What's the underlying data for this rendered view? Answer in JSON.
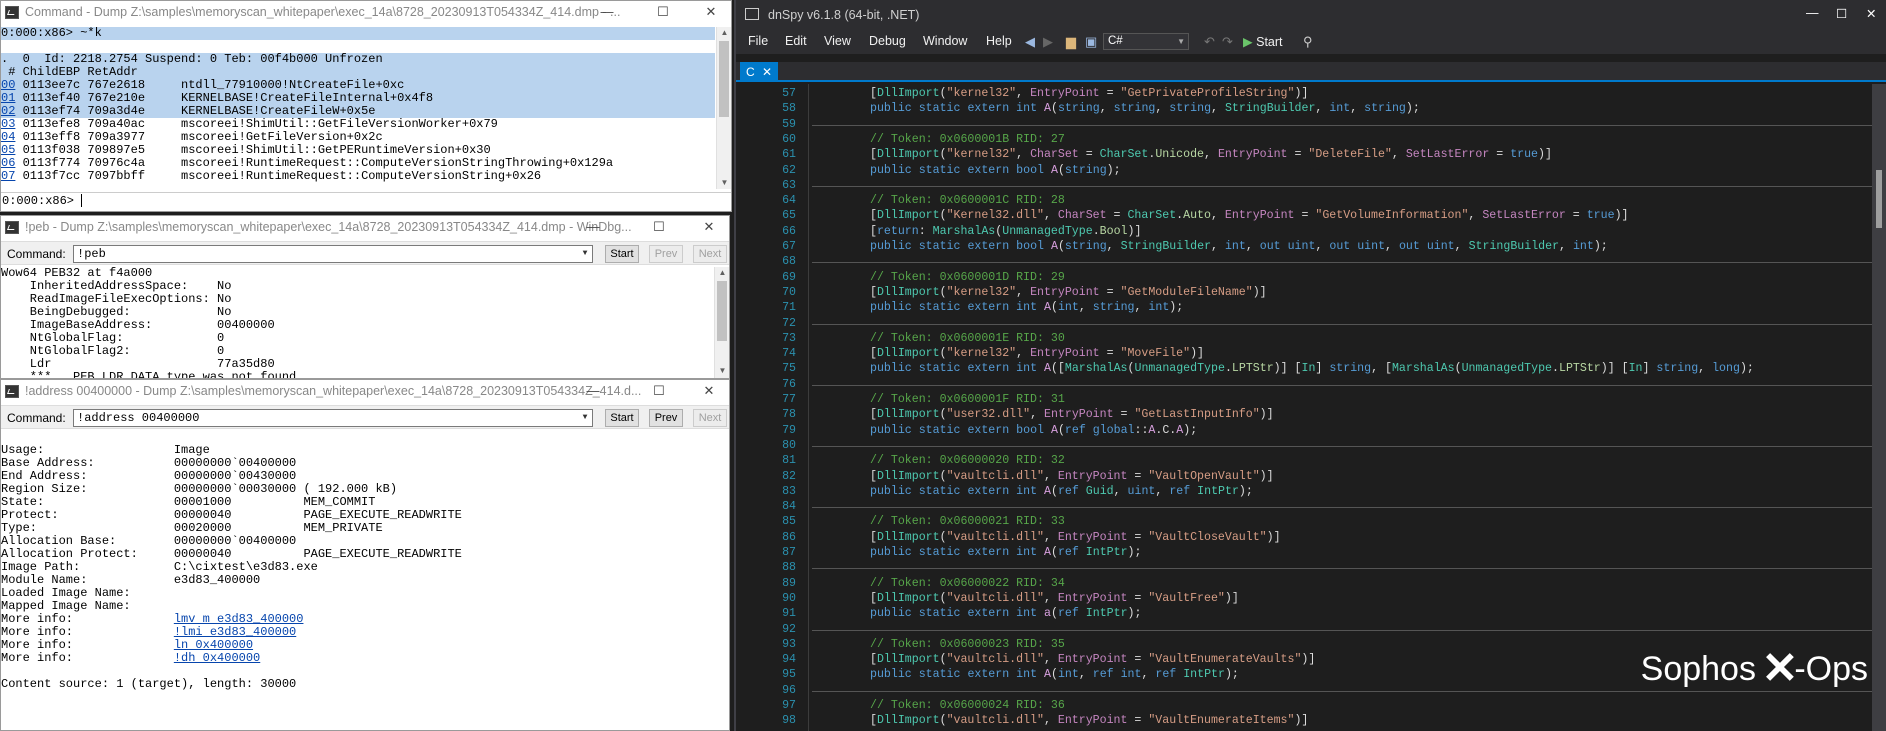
{
  "windbg_cmd": {
    "title": "Command - Dump Z:\\samples\\memoryscan_whitepaper\\exec_14a\\8728_20230913T054334Z_414.dmp - ...",
    "lines": [
      "0:000:x86> ~*k",
      "",
      ".  0  Id: 2218.2754 Suspend: 0 Teb: 00f4b000 Unfrozen",
      " # ChildEBP RetAddr",
      "00 0113ee7c 767e2618     ntdll_77910000!NtCreateFile+0xc",
      "01 0113ef40 767e210e     KERNELBASE!CreateFileInternal+0x4f8",
      "02 0113ef74 709a3d4e     KERNELBASE!CreateFileW+0x5e",
      "03 0113efe8 709a40ac     mscoreei!ShimUtil::GetFileVersionWorker+0x79",
      "04 0113eff8 709a3977     mscoreei!GetFileVersion+0x2c",
      "05 0113f038 709897e5     mscoreei!ShimUtil::GetPERuntimeVersion+0x30",
      "06 0113f774 70976c4a     mscoreei!RuntimeRequest::ComputeVersionStringThrowing+0x129a",
      "07 0113f7cc 7097bbff     mscoreei!RuntimeRequest::ComputeVersionString+0x26"
    ],
    "prompt": "0:000:x86>"
  },
  "windbg_peb": {
    "title": "!peb - Dump Z:\\samples\\memoryscan_whitepaper\\exec_14a\\8728_20230913T054334Z_414.dmp - WinDbg...",
    "command_label": "Command:",
    "command_value": "!peb",
    "start_label": "Start",
    "prev_label": "Prev",
    "next_label": "Next",
    "lines": [
      "Wow64 PEB32 at f4a000",
      "    InheritedAddressSpace:    No",
      "    ReadImageFileExecOptions: No",
      "    BeingDebugged:            No",
      "    ImageBaseAddress:         00400000",
      "    NtGlobalFlag:             0",
      "    NtGlobalFlag2:            0",
      "    Ldr                       77a35d80",
      "    ***  _PEB_LDR_DATA type was not found..."
    ]
  },
  "windbg_addr": {
    "title": "!address 00400000 - Dump Z:\\samples\\memoryscan_whitepaper\\exec_14a\\8728_20230913T054334Z_414.d...",
    "command_label": "Command:",
    "command_value": "!address 00400000",
    "start_label": "Start",
    "prev_label": "Prev",
    "next_label": "Next",
    "lines": [
      "",
      "Usage:                  Image",
      "Base Address:           00000000`00400000",
      "End Address:            00000000`00430000",
      "Region Size:            00000000`00030000 ( 192.000 kB)",
      "State:                  00001000          MEM_COMMIT",
      "Protect:                00000040          PAGE_EXECUTE_READWRITE",
      "Type:                   00020000          MEM_PRIVATE",
      "Allocation Base:        00000000`00400000",
      "Allocation Protect:     00000040          PAGE_EXECUTE_READWRITE",
      "Image Path:             C:\\cixtest\\e3d83.exe",
      "Module Name:            e3d83_400000",
      "Loaded Image Name:",
      "Mapped Image Name:"
    ],
    "more_info_label": "More info:",
    "more_info_links": [
      "lmv m e3d83_400000",
      "!lmi e3d83_400000",
      "ln 0x400000",
      "!dh 0x400000"
    ],
    "content_source": "Content source: 1 (target), length: 30000"
  },
  "dnspy": {
    "title": "dnSpy v6.1.8 (64-bit, .NET)",
    "menu": [
      "File",
      "Edit",
      "View",
      "Debug",
      "Window",
      "Help"
    ],
    "language": "C#",
    "start_label": "Start",
    "tab_label": "C",
    "code": [
      {
        "n": "57",
        "t": "[DllImport(\"kernel32\", EntryPoint = \"GetPrivateProfileString\")]"
      },
      {
        "n": "58",
        "t": "public static extern int A(string, string, string, StringBuilder, int, string);"
      },
      {
        "n": "59",
        "t": ""
      },
      {
        "n": "60",
        "t": "// Token: 0x0600001B RID: 27"
      },
      {
        "n": "61",
        "t": "[DllImport(\"kernel32\", CharSet = CharSet.Unicode, EntryPoint = \"DeleteFile\", SetLastError = true)]"
      },
      {
        "n": "62",
        "t": "public static extern bool A(string);"
      },
      {
        "n": "63",
        "t": ""
      },
      {
        "n": "64",
        "t": "// Token: 0x0600001C RID: 28"
      },
      {
        "n": "65",
        "t": "[DllImport(\"Kernel32.dll\", CharSet = CharSet.Auto, EntryPoint = \"GetVolumeInformation\", SetLastError = true)]"
      },
      {
        "n": "66",
        "t": "[return: MarshalAs(UnmanagedType.Bool)]"
      },
      {
        "n": "67",
        "t": "public static extern bool A(string, StringBuilder, int, out uint, out uint, out uint, StringBuilder, int);"
      },
      {
        "n": "68",
        "t": ""
      },
      {
        "n": "69",
        "t": "// Token: 0x0600001D RID: 29"
      },
      {
        "n": "70",
        "t": "[DllImport(\"kernel32\", EntryPoint = \"GetModuleFileName\")]"
      },
      {
        "n": "71",
        "t": "public static extern int A(int, string, int);"
      },
      {
        "n": "72",
        "t": ""
      },
      {
        "n": "73",
        "t": "// Token: 0x0600001E RID: 30"
      },
      {
        "n": "74",
        "t": "[DllImport(\"kernel32\", EntryPoint = \"MoveFile\")]"
      },
      {
        "n": "75",
        "t": "public static extern int A([MarshalAs(UnmanagedType.LPTStr)] [In] string, [MarshalAs(UnmanagedType.LPTStr)] [In] string, long);"
      },
      {
        "n": "76",
        "t": ""
      },
      {
        "n": "77",
        "t": "// Token: 0x0600001F RID: 31"
      },
      {
        "n": "78",
        "t": "[DllImport(\"user32.dll\", EntryPoint = \"GetLastInputInfo\")]"
      },
      {
        "n": "79",
        "t": "public static extern bool A(ref global::A.C.A);"
      },
      {
        "n": "80",
        "t": ""
      },
      {
        "n": "81",
        "t": "// Token: 0x06000020 RID: 32"
      },
      {
        "n": "82",
        "t": "[DllImport(\"vaultcli.dll\", EntryPoint = \"VaultOpenVault\")]"
      },
      {
        "n": "83",
        "t": "public static extern int A(ref Guid, uint, ref IntPtr);"
      },
      {
        "n": "84",
        "t": ""
      },
      {
        "n": "85",
        "t": "// Token: 0x06000021 RID: 33"
      },
      {
        "n": "86",
        "t": "[DllImport(\"vaultcli.dll\", EntryPoint = \"VaultCloseVault\")]"
      },
      {
        "n": "87",
        "t": "public static extern int A(ref IntPtr);"
      },
      {
        "n": "88",
        "t": ""
      },
      {
        "n": "89",
        "t": "// Token: 0x06000022 RID: 34"
      },
      {
        "n": "90",
        "t": "[DllImport(\"vaultcli.dll\", EntryPoint = \"VaultFree\")]"
      },
      {
        "n": "91",
        "t": "public static extern int a(ref IntPtr);"
      },
      {
        "n": "92",
        "t": ""
      },
      {
        "n": "93",
        "t": "// Token: 0x06000023 RID: 35"
      },
      {
        "n": "94",
        "t": "[DllImport(\"vaultcli.dll\", EntryPoint = \"VaultEnumerateVaults\")]"
      },
      {
        "n": "95",
        "t": "public static extern int A(int, ref int, ref IntPtr);"
      },
      {
        "n": "96",
        "t": ""
      },
      {
        "n": "97",
        "t": "// Token: 0x06000024 RID: 36"
      },
      {
        "n": "98",
        "t": "[DllImport(\"vaultcli.dll\", EntryPoint = \"VaultEnumerateItems\")]"
      }
    ]
  },
  "logo": {
    "brand": "Sophos",
    "suffix": "X-Ops"
  }
}
